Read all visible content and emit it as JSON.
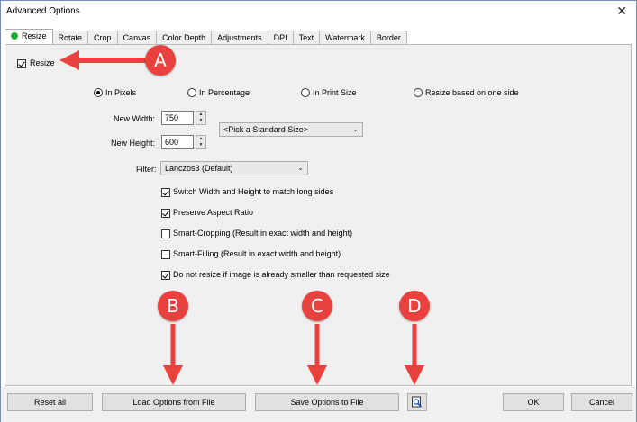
{
  "window": {
    "title": "Advanced Options",
    "close_symbol": "✕"
  },
  "tabs": [
    {
      "label": "Resize",
      "active": true
    },
    {
      "label": "Rotate"
    },
    {
      "label": "Crop"
    },
    {
      "label": "Canvas"
    },
    {
      "label": "Color Depth"
    },
    {
      "label": "Adjustments"
    },
    {
      "label": "DPI"
    },
    {
      "label": "Text"
    },
    {
      "label": "Watermark"
    },
    {
      "label": "Border"
    }
  ],
  "resize": {
    "enable_label": "Resize",
    "modes": {
      "pixels": "In Pixels",
      "percentage": "In Percentage",
      "print": "In Print Size",
      "one_side": "Resize based on one side"
    },
    "new_width_label": "New Width:",
    "new_width_value": "750",
    "new_height_label": "New Height:",
    "new_height_value": "600",
    "standard_size": "<Pick a Standard Size>",
    "filter_label": "Filter:",
    "filter_value": "Lanczos3 (Default)",
    "options": {
      "switch": "Switch Width and Height to match long sides",
      "aspect": "Preserve Aspect Ratio",
      "smart_crop": "Smart-Cropping (Result in exact width and height)",
      "smart_fill": "Smart-Filling (Result in exact width and height)",
      "no_upscale": "Do not resize if image is already smaller than requested size"
    }
  },
  "footer": {
    "reset": "Reset all",
    "load": "Load Options from File",
    "save": "Save Options to File",
    "ok": "OK",
    "cancel": "Cancel"
  },
  "markers": {
    "a": "A",
    "b": "B",
    "c": "C",
    "d": "D"
  },
  "colors": {
    "marker": "#e8413e",
    "active_dot": "#1fae3c"
  }
}
